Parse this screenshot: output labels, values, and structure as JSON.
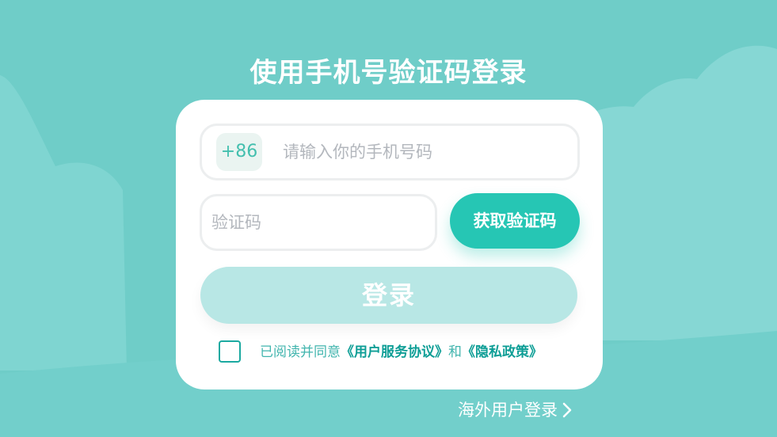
{
  "page": {
    "title": "使用手机号验证码登录"
  },
  "login_form": {
    "country_code": "+86",
    "phone_placeholder": "请输入你的手机号码",
    "code_placeholder": "验证码",
    "get_code_label": "获取验证码",
    "login_label": "登录"
  },
  "agreement": {
    "checked": false,
    "prefix": "已阅读并同意",
    "terms_link": "《用户服务协议》",
    "and": "和",
    "privacy_link": "《隐私政策》"
  },
  "footer": {
    "overseas_login": "海外用户登录"
  },
  "colors": {
    "background": "#6fcdc8",
    "accent": "#26c6b4",
    "login_button_disabled": "#b8e7e5",
    "card": "#ffffff"
  },
  "icons": {
    "overseas_chevron": "chevron-right-icon"
  }
}
